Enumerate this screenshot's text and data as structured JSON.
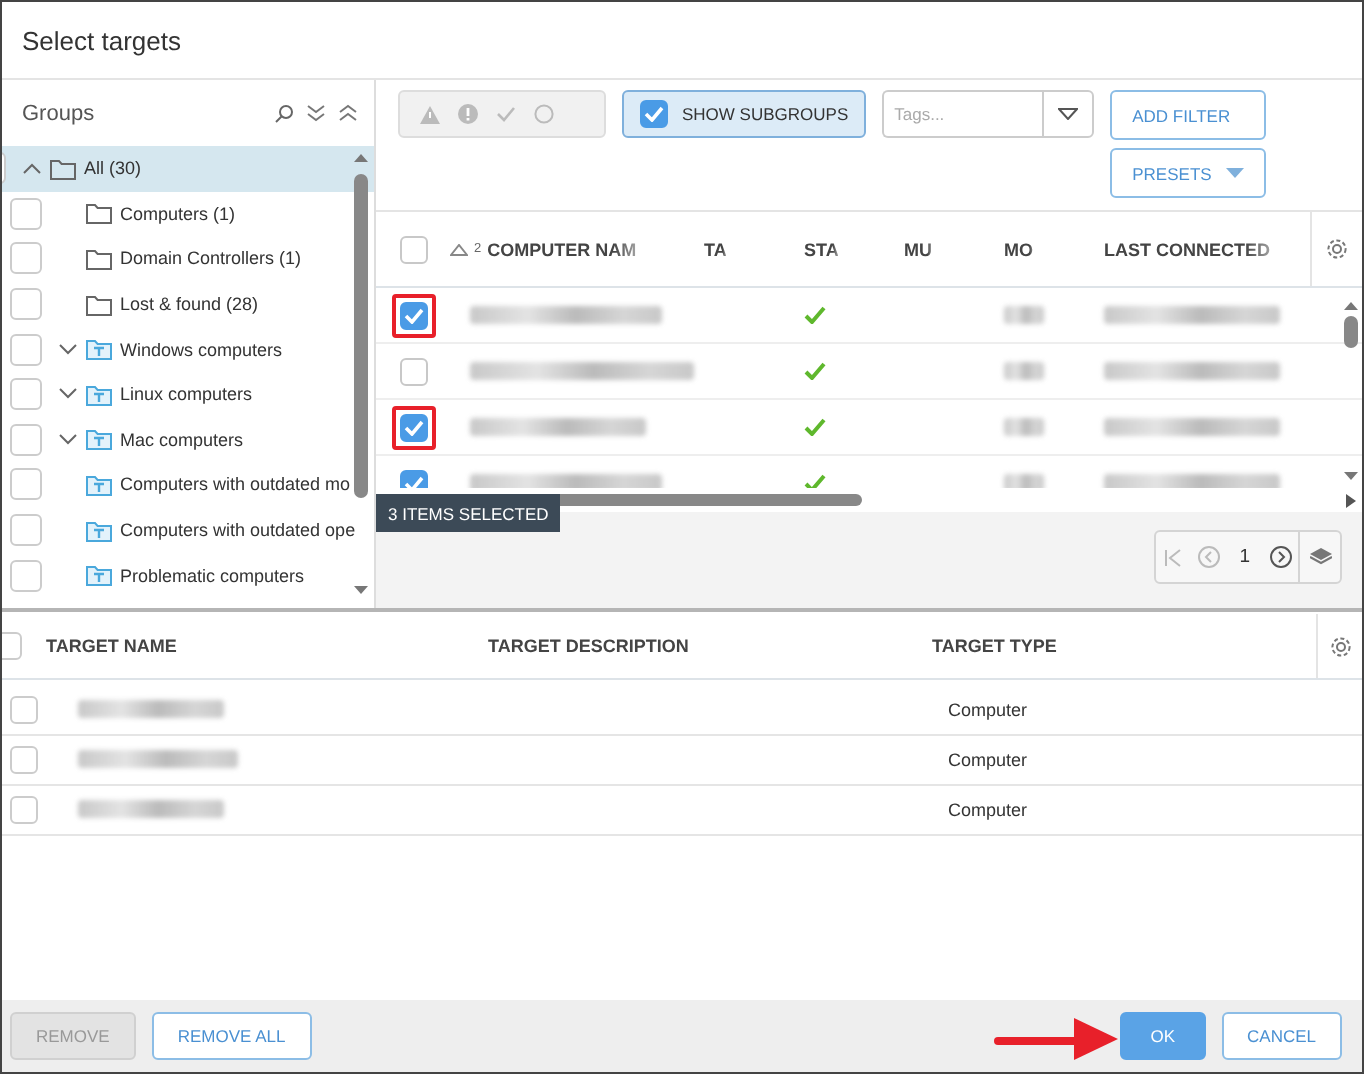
{
  "window": {
    "title": "Select targets"
  },
  "groups": {
    "title": "Groups",
    "tree": [
      {
        "label": "All (30)",
        "kind": "folder",
        "expanded": true,
        "selected": true,
        "checked": false,
        "children": [
          {
            "label": "Computers (1)",
            "kind": "folder",
            "selected": false,
            "checked": false
          },
          {
            "label": "Domain Controllers (1)",
            "kind": "folder",
            "selected": false,
            "checked": false
          },
          {
            "label": "Lost & found (28)",
            "kind": "folder",
            "selected": false,
            "checked": false
          },
          {
            "label": "Windows computers",
            "kind": "dynamic",
            "expanded": false,
            "selected": false,
            "checked": false
          },
          {
            "label": "Linux computers",
            "kind": "dynamic",
            "expanded": false,
            "selected": false,
            "checked": false
          },
          {
            "label": "Mac computers",
            "kind": "dynamic",
            "expanded": false,
            "selected": false,
            "checked": false
          },
          {
            "label": "Computers with outdated mo",
            "kind": "dynamic",
            "selected": false,
            "checked": false
          },
          {
            "label": "Computers with outdated ope",
            "kind": "dynamic",
            "selected": false,
            "checked": false
          },
          {
            "label": "Problematic computers",
            "kind": "dynamic",
            "selected": false,
            "checked": false
          }
        ]
      }
    ]
  },
  "toolbar": {
    "status_filters": {
      "disabled": true,
      "items": [
        {
          "kind": "warning"
        },
        {
          "kind": "error"
        },
        {
          "kind": "ok"
        },
        {
          "kind": "none"
        }
      ]
    },
    "show_subgroups": {
      "label": "SHOW SUBGROUPS",
      "checked": true
    },
    "tags": {
      "placeholder": "Tags..."
    },
    "add_filter": "ADD FILTER",
    "presets": "PRESETS"
  },
  "computers": {
    "all_checked": false,
    "columns": [
      {
        "label": "COMPUTER NAM",
        "sort_ascending": true,
        "sort_index": "2"
      },
      {
        "label": "TA"
      },
      {
        "label": "STA"
      },
      {
        "label": "MU"
      },
      {
        "label": "MO"
      },
      {
        "label": "LAST CONNECTED"
      }
    ],
    "rows": [
      {
        "checked": true,
        "highlighted": true,
        "status_ok": true
      },
      {
        "checked": false,
        "highlighted": false,
        "status_ok": true
      },
      {
        "checked": true,
        "highlighted": true,
        "status_ok": true
      },
      {
        "checked": true,
        "highlighted": false,
        "status_ok": true
      }
    ],
    "selection_tooltip": "3 ITEMS SELECTED",
    "pager": {
      "page": "1"
    }
  },
  "targets": {
    "all_checked": false,
    "columns": [
      "TARGET NAME",
      "TARGET DESCRIPTION",
      "TARGET TYPE"
    ],
    "rows": [
      {
        "checked": false,
        "type": "Computer"
      },
      {
        "checked": false,
        "type": "Computer"
      },
      {
        "checked": false,
        "type": "Computer"
      }
    ]
  },
  "footer": {
    "buttons": [
      {
        "label": "REMOVE",
        "kind": "secondary",
        "disabled": true,
        "pointed": false
      },
      {
        "label": "REMOVE ALL",
        "kind": "secondary",
        "disabled": false,
        "pointed": false
      },
      {
        "label": "OK",
        "kind": "primary",
        "disabled": false,
        "pointed": true
      },
      {
        "label": "CANCEL",
        "kind": "secondary",
        "disabled": false,
        "pointed": false
      }
    ]
  }
}
